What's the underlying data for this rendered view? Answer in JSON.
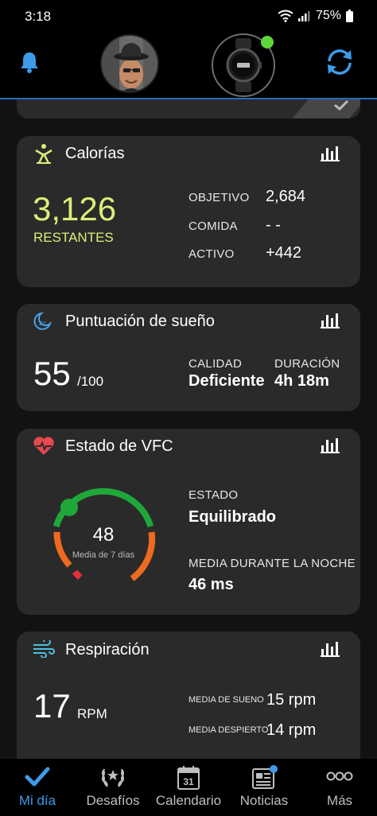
{
  "status_bar": {
    "time": "3:18",
    "battery": "75%"
  },
  "colors": {
    "accent_blue": "#3d9be9",
    "lime": "#d7f07a",
    "green": "#1fa83a",
    "orange": "#ee6a1f",
    "red": "#e5303a"
  },
  "header": {
    "icons": [
      "bell-icon",
      "avatar",
      "watch",
      "sync-icon"
    ]
  },
  "calories": {
    "title": "Calorías",
    "remaining_value": "3,126",
    "remaining_label": "RESTANTES",
    "rows": [
      {
        "label": "OBJETIVO",
        "value": "2,684"
      },
      {
        "label": "COMIDA",
        "value": "- -"
      },
      {
        "label": "ACTIVO",
        "value": "+442"
      }
    ]
  },
  "sleep": {
    "title": "Puntuación de sueño",
    "score": "55",
    "score_max": "/100",
    "quality_label": "CALIDAD",
    "quality_value": "Deficiente",
    "duration_label": "DURACIÓN",
    "duration_value": "4h 18m"
  },
  "hrv": {
    "title": "Estado de VFC",
    "gauge_value": "48",
    "gauge_caption": "Media de 7 días",
    "status_label": "ESTADO",
    "status_value": "Equilibrado",
    "night_label": "MEDIA DURANTE LA NOCHE",
    "night_value": "46 ms"
  },
  "respiration": {
    "title": "Respiración",
    "value": "17",
    "unit": "RPM",
    "sleep_label": "MEDIA DE SUENO",
    "sleep_value": "15 rpm",
    "awake_label": "MEDIA DESPIERTO",
    "awake_value": "14 rpm"
  },
  "nav": {
    "items": [
      {
        "label": "Mi día",
        "icon": "check-icon"
      },
      {
        "label": "Desafíos",
        "icon": "laurel-icon"
      },
      {
        "label": "Calendario",
        "icon": "calendar-icon",
        "day": "31"
      },
      {
        "label": "Noticias",
        "icon": "news-icon"
      },
      {
        "label": "Más",
        "icon": "more-icon"
      }
    ]
  }
}
